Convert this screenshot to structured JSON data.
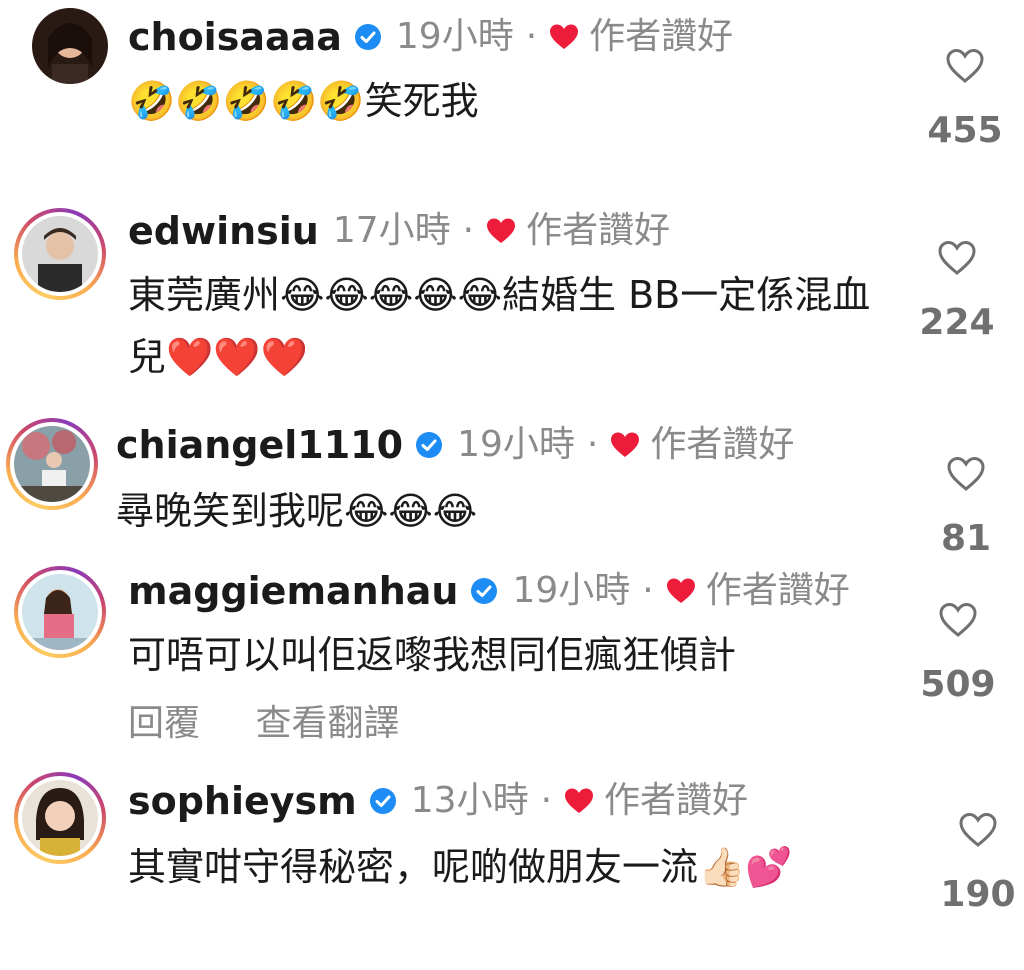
{
  "comments": [
    {
      "username": "choisaaaa",
      "verified": true,
      "time": "19小時",
      "liked_by_author_label": "作者讚好",
      "text": "🤣🤣🤣🤣🤣笑死我",
      "likes": "455",
      "story_ring": false
    },
    {
      "username": "edwinsiu",
      "verified": false,
      "time": "17小時",
      "liked_by_author_label": "作者讚好",
      "text": "東莞廣州😂😂😂😂😂結婚生 BB一定係混血兒❤️❤️❤️",
      "likes": "224",
      "story_ring": true
    },
    {
      "username": "chiangel1110",
      "verified": true,
      "time": "19小時",
      "liked_by_author_label": "作者讚好",
      "text": "尋晚笑到我呢😂😂😂",
      "likes": "81",
      "story_ring": true
    },
    {
      "username": "maggiemanhau",
      "verified": true,
      "time": "19小時",
      "liked_by_author_label": "作者讚好",
      "text": "可唔可以叫佢返嚟我想同佢瘋狂傾計",
      "likes": "509",
      "story_ring": true,
      "actions": [
        "回覆",
        "查看翻譯"
      ]
    },
    {
      "username": "sophieysm",
      "verified": true,
      "time": "13小時",
      "liked_by_author_label": "作者讚好",
      "text": "其實咁守得秘密，呢啲做朋友一流👍🏻💕",
      "likes": "190",
      "story_ring": true
    }
  ],
  "separator": "·",
  "colors": {
    "heart_red": "#ed1c3a",
    "verified_blue": "#1d8cf4",
    "muted_text": "#8a8a8a"
  }
}
